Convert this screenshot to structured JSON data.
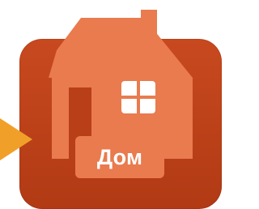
{
  "tile": {
    "label": "Дом",
    "icon": "house-icon",
    "colors": {
      "tile": "#b83f17",
      "house": "#e97b4f",
      "pointer": "#f0a028",
      "label_text": "#ffffff"
    }
  }
}
